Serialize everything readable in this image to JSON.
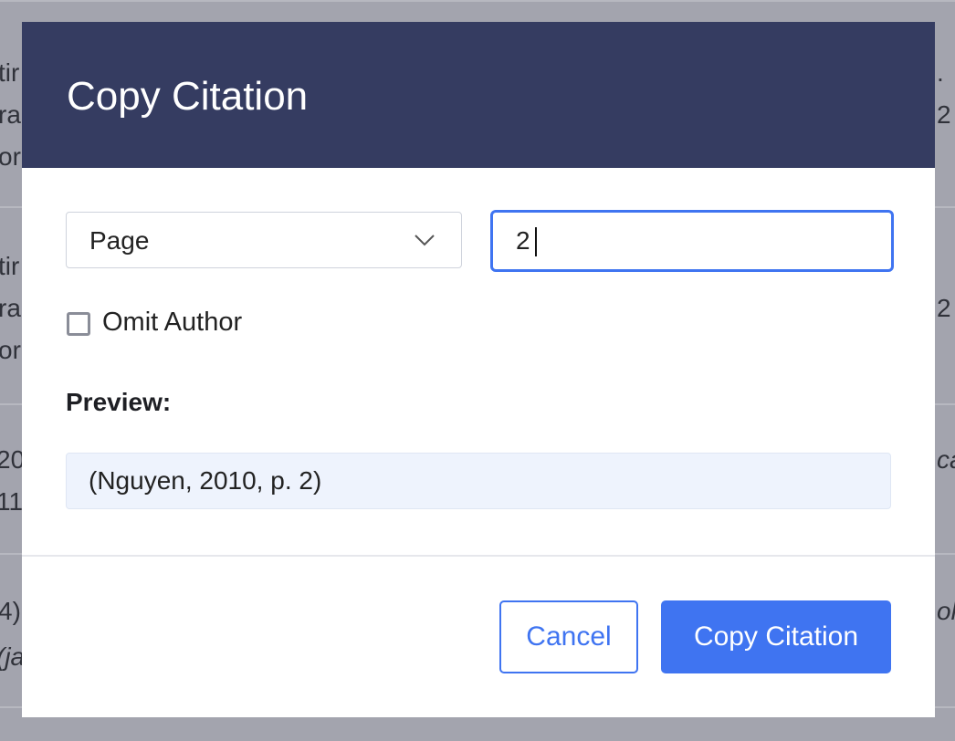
{
  "dialog": {
    "title": "Copy Citation"
  },
  "locator": {
    "type_selected": "Page",
    "value": "2"
  },
  "omit_author": {
    "label": "Omit Author",
    "checked": false
  },
  "preview": {
    "label": "Preview:",
    "text": "(Nguyen, 2010, p. 2)"
  },
  "buttons": {
    "cancel": "Cancel",
    "copy": "Copy Citation"
  },
  "background_fragments": {
    "left": [
      "tir",
      "ra",
      "org",
      "tir",
      "ra",
      "org",
      "20",
      "11",
      "4)",
      "(ja"
    ],
    "right": [
      ".",
      "2",
      "2",
      "ca",
      "oli"
    ]
  },
  "colors": {
    "header": "#353c61",
    "accent": "#3f74f1",
    "preview_bg": "#eef3fd"
  },
  "icons": {
    "select_arrow": "chevron-down-icon"
  }
}
